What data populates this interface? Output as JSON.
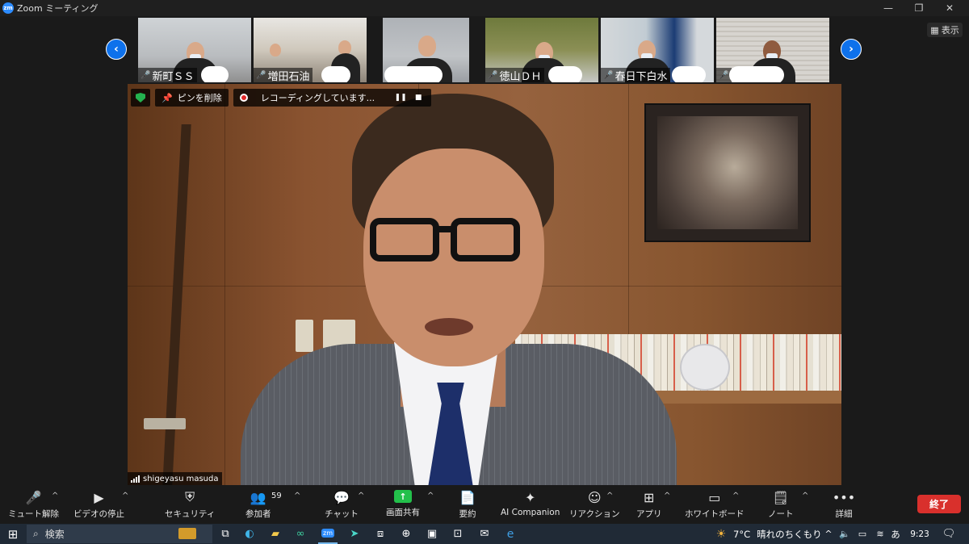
{
  "window": {
    "title": "Zoom ミーティング",
    "logo_text": "zm"
  },
  "view_button": {
    "label": "表示"
  },
  "participants": [
    {
      "name": "新町ＳＳ",
      "muted": true
    },
    {
      "name": "増田石油",
      "muted": true
    },
    {
      "name": "",
      "muted": false
    },
    {
      "name": "徳山ＤＨ",
      "muted": true
    },
    {
      "name": "春日下白水",
      "muted": true
    },
    {
      "name": "",
      "muted": true
    }
  ],
  "video": {
    "unpin_label": "ピンを削除",
    "recording_label": "レコーディングしています...",
    "speaker_name": "shigeyasu masuda"
  },
  "toolbar": {
    "mute": "ミュート解除",
    "video": "ビデオの停止",
    "security": "セキュリティ",
    "participants": "参加者",
    "participant_count": "59",
    "chat": "チャット",
    "share": "画面共有",
    "summary": "要約",
    "ai": "AI Companion",
    "reactions": "リアクション",
    "apps": "アプリ",
    "whiteboard": "ホワイトボード",
    "notes": "ノート",
    "more": "詳細",
    "end": "終了"
  },
  "taskbar": {
    "search_placeholder": "検索",
    "weather_temp": "7°C",
    "weather_text": "晴れのちくもり",
    "ime": "あ",
    "time": "9:23"
  },
  "colors": {
    "accent": "#0e71eb",
    "share_green": "#23c04b",
    "end_red": "#d9302c",
    "mute_red": "#e02828"
  }
}
